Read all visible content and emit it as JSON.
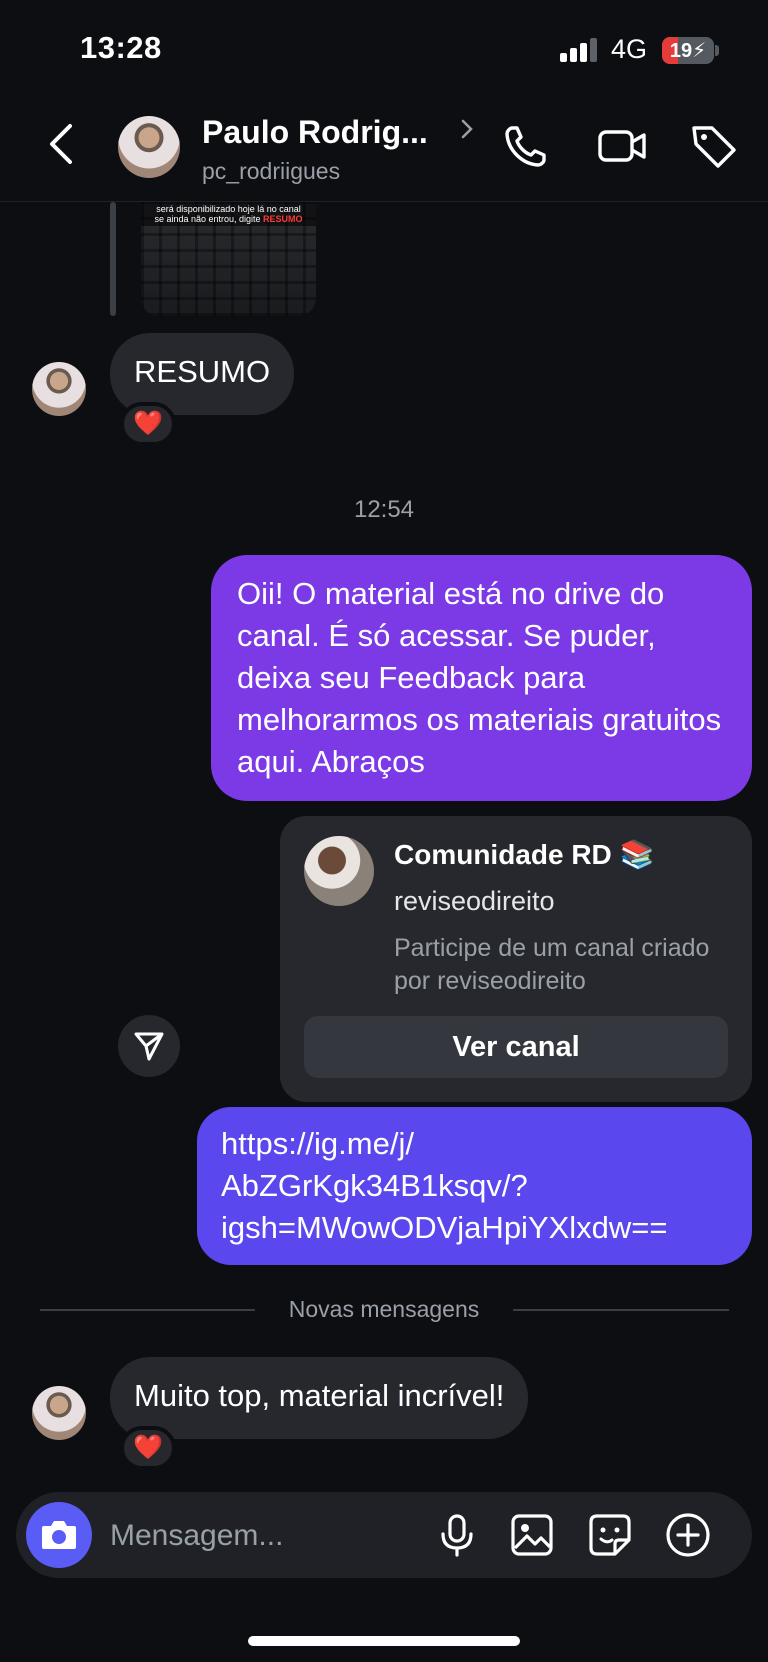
{
  "status_bar": {
    "time": "13:28",
    "network": "4G",
    "battery": "19",
    "battery_level": 0.19
  },
  "header": {
    "contact_name": "Paulo Rodrig...",
    "username": "pc_rodriigues"
  },
  "media": {
    "caption_line1": "será disponibilizado hoje lá no canal",
    "caption_line2": "se ainda não entrou, digite",
    "caption_keyword": "RESUMO"
  },
  "messages": {
    "resumo": {
      "text": "RESUMO",
      "reaction": "❤️"
    },
    "timestamp": "12:54",
    "reply": {
      "text": "Oii! O material está no drive do canal. É só acessar. Se puder, deixa seu Feedback para melhorarmos os materiais gratuitos aqui. Abraços"
    },
    "channel_card": {
      "title": "Comunidade RD 📚",
      "username": "reviseodireito",
      "description": "Participe de um canal criado por reviseodireito",
      "button": "Ver canal"
    },
    "link": {
      "line1": "https://ig.me/j/",
      "line2": "AbZGrKgk34B1ksqv/?",
      "line3": "igsh=MWowODVjaHpiYXlxdw=="
    },
    "new_messages_label": "Novas mensagens",
    "last": {
      "text": "Muito top, material incrível!",
      "reaction": "❤️"
    }
  },
  "composer": {
    "placeholder": "Mensagem..."
  },
  "colors": {
    "background": "#0c0e12",
    "incoming_bubble": "#26282d",
    "outgoing_bubble": "#7b3ae6",
    "link_bubble": "#5b47ee",
    "camera_button": "#5a5cf6"
  }
}
